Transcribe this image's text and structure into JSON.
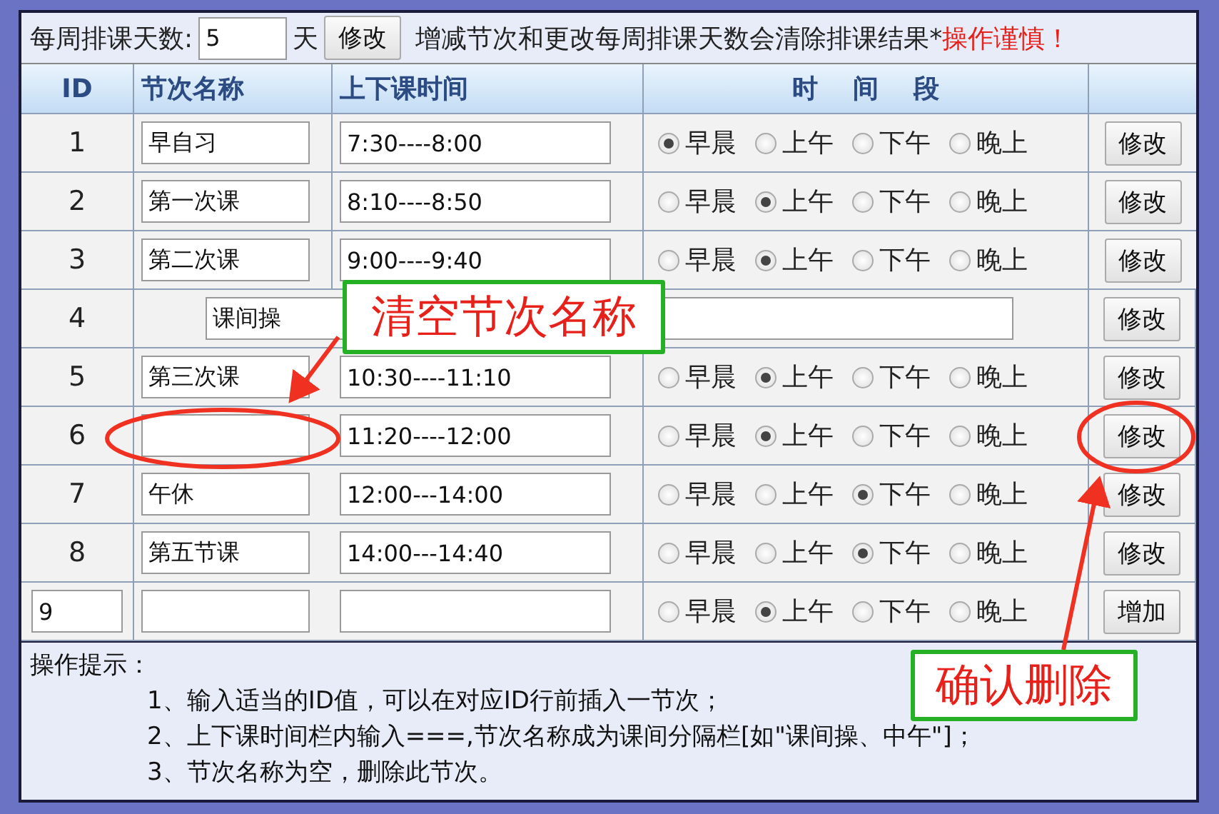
{
  "top_bar": {
    "label": "每周排课天数:",
    "days_value": "5",
    "unit": "天",
    "button": "修改",
    "notice": "增减节次和更改每周排课天数会清除排课结果*",
    "warning": "操作谨慎！"
  },
  "columns": [
    "ID",
    "节次名称",
    "上下课时间",
    "时 间 段"
  ],
  "rows": [
    {
      "kind": "lesson",
      "id": "1",
      "name": "早自习",
      "time": "7:30----8:00",
      "periods": [
        {
          "label": "早晨",
          "selected": true
        },
        {
          "label": "上午",
          "selected": false
        },
        {
          "label": "下午",
          "selected": false
        },
        {
          "label": "晚上",
          "selected": false
        }
      ],
      "button": "修改"
    },
    {
      "kind": "lesson",
      "id": "2",
      "name": "第一次课",
      "time": "8:10----8:50",
      "periods": [
        {
          "label": "早晨",
          "selected": false
        },
        {
          "label": "上午",
          "selected": true
        },
        {
          "label": "下午",
          "selected": false
        },
        {
          "label": "晚上",
          "selected": false
        }
      ],
      "button": "修改"
    },
    {
      "kind": "lesson",
      "id": "3",
      "name": "第二次课",
      "time": "9:00----9:40",
      "periods": [
        {
          "label": "早晨",
          "selected": false
        },
        {
          "label": "上午",
          "selected": true
        },
        {
          "label": "下午",
          "selected": false
        },
        {
          "label": "晚上",
          "selected": false
        }
      ],
      "button": "修改"
    },
    {
      "kind": "break",
      "id": "4",
      "name": "课间操",
      "button": "修改"
    },
    {
      "kind": "lesson",
      "id": "5",
      "name": "第三次课",
      "time": "10:30----11:10",
      "periods": [
        {
          "label": "早晨",
          "selected": false
        },
        {
          "label": "上午",
          "selected": true
        },
        {
          "label": "下午",
          "selected": false
        },
        {
          "label": "晚上",
          "selected": false
        }
      ],
      "button": "修改"
    },
    {
      "kind": "lesson",
      "id": "6",
      "time": "11:20----12:00",
      "periods": [
        {
          "label": "早晨",
          "selected": false
        },
        {
          "label": "上午",
          "selected": true
        },
        {
          "label": "下午",
          "selected": false
        },
        {
          "label": "晚上",
          "selected": false
        }
      ],
      "button": "修改"
    },
    {
      "kind": "lesson",
      "id": "7",
      "name": "午休",
      "time": "12:00---14:00",
      "periods": [
        {
          "label": "早晨",
          "selected": false
        },
        {
          "label": "上午",
          "selected": false
        },
        {
          "label": "下午",
          "selected": true
        },
        {
          "label": "晚上",
          "selected": false
        }
      ],
      "button": "修改"
    },
    {
      "kind": "lesson",
      "id": "8",
      "name": "第五节课",
      "time": "14:00---14:40",
      "periods": [
        {
          "label": "早晨",
          "selected": false
        },
        {
          "label": "上午",
          "selected": false
        },
        {
          "label": "下午",
          "selected": true
        },
        {
          "label": "晚上",
          "selected": false
        }
      ],
      "button": "修改"
    },
    {
      "kind": "new",
      "id": "9",
      "periods": [
        {
          "label": "早晨",
          "selected": false
        },
        {
          "label": "上午",
          "selected": true
        },
        {
          "label": "下午",
          "selected": false
        },
        {
          "label": "晚上",
          "selected": false
        }
      ],
      "button": "增加"
    }
  ],
  "notes": {
    "title": "操作提示：",
    "items": [
      "1、输入适当的ID值，可以在对应ID行前插入一节次；",
      "2、上下课时间栏内输入===,节次名称成为课间分隔栏[如\"课间操、中午\"]；",
      "3、节次名称为空，删除此节次。"
    ]
  },
  "annotations": [
    {
      "kind": "callout",
      "text": "清空节次名称"
    },
    {
      "kind": "callout",
      "text": "确认删除"
    }
  ]
}
